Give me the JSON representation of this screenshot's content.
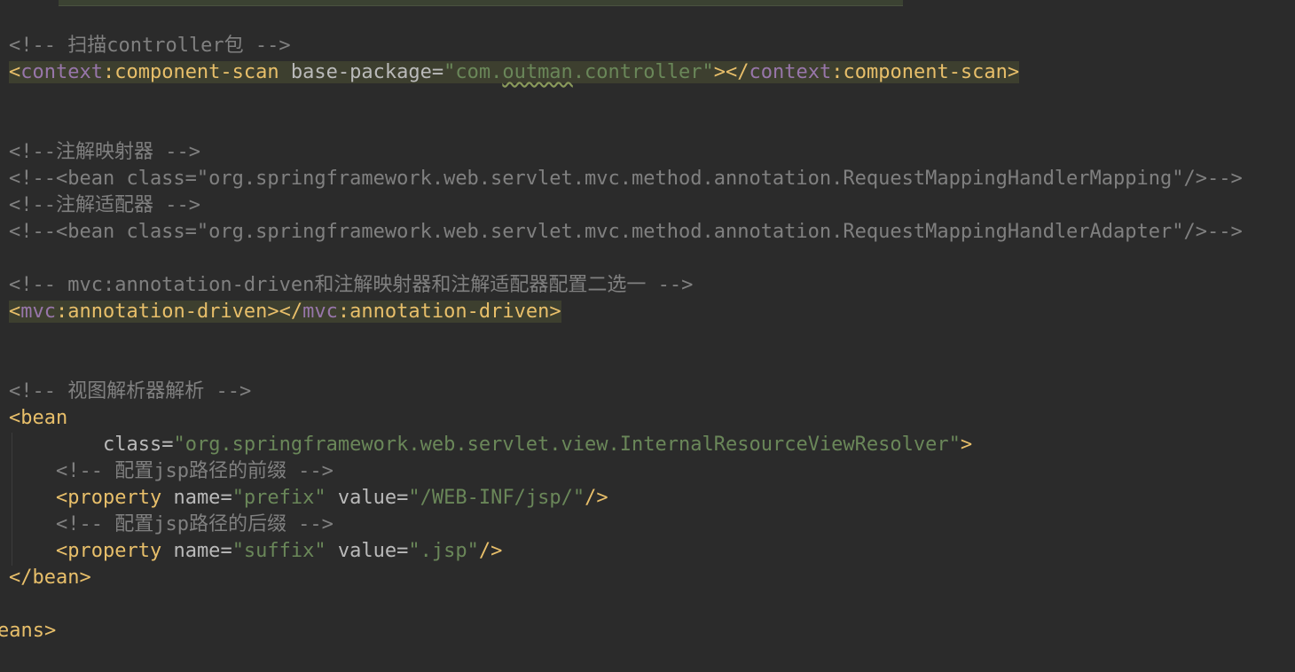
{
  "colors": {
    "background": "#2b2b2b",
    "tag": "#e8bf6a",
    "namespace": "#9876aa",
    "attribute": "#bababa",
    "value": "#6a8759",
    "comment": "#808080",
    "highlight": "#3d3f2f"
  },
  "code": {
    "comment_scan": "<!-- 扫描controller包 -->",
    "scan": {
      "open_lt": "<",
      "ns": "context",
      "sep": ":",
      "name": "component-scan",
      "attr": " base-package",
      "eq": "=",
      "val_a": "\"com.",
      "val_squiggle": "outman",
      "val_b": ".controller\"",
      "close_open": "></",
      "ns2": "context",
      "sep2": ":",
      "name2": "component-scan",
      "gt": ">"
    },
    "comment_mapper": "<!--注解映射器 -->",
    "comment_mapping_bean": "<!--<bean class=\"org.springframework.web.servlet.mvc.method.annotation.RequestMappingHandlerMapping\"/>-->",
    "comment_adapter": "<!--注解适配器 -->",
    "comment_adapter_bean": "<!--<bean class=\"org.springframework.web.servlet.mvc.method.annotation.RequestMappingHandlerAdapter\"/>-->",
    "comment_mvc": "<!-- mvc:annotation-driven和注解映射器和注解适配器配置二选一 -->",
    "mvc": {
      "open_lt": "<",
      "ns": "mvc",
      "sep": ":",
      "name": "annotation-driven",
      "close_open": "></",
      "ns2": "mvc",
      "sep2": ":",
      "name2": "annotation-driven",
      "gt": ">"
    },
    "comment_view": "<!-- 视图解析器解析 -->",
    "bean_open": "<bean",
    "bean_class": {
      "indent": "        ",
      "attr": "class",
      "eq": "=",
      "val": "\"org.springframework.web.servlet.view.InternalResourceViewResolver\"",
      "gt": ">"
    },
    "comment_prefix": "    <!-- 配置jsp路径的前缀 -->",
    "prop_prefix": {
      "indent": "    ",
      "tag": "<property",
      "attr1": " name",
      "eq1": "=",
      "val1": "\"prefix\"",
      "attr2": " value",
      "eq2": "=",
      "val2": "\"/WEB-INF/jsp/\"",
      "end": "/>"
    },
    "comment_suffix": "    <!-- 配置jsp路径的后缀 -->",
    "prop_suffix": {
      "indent": "    ",
      "tag": "<property",
      "attr1": " name",
      "eq1": "=",
      "val1": "\"suffix\"",
      "attr2": " value",
      "eq2": "=",
      "val2": "\".jsp\"",
      "end": "/>"
    },
    "bean_close": "</bean>",
    "beans_close": "eans>"
  }
}
